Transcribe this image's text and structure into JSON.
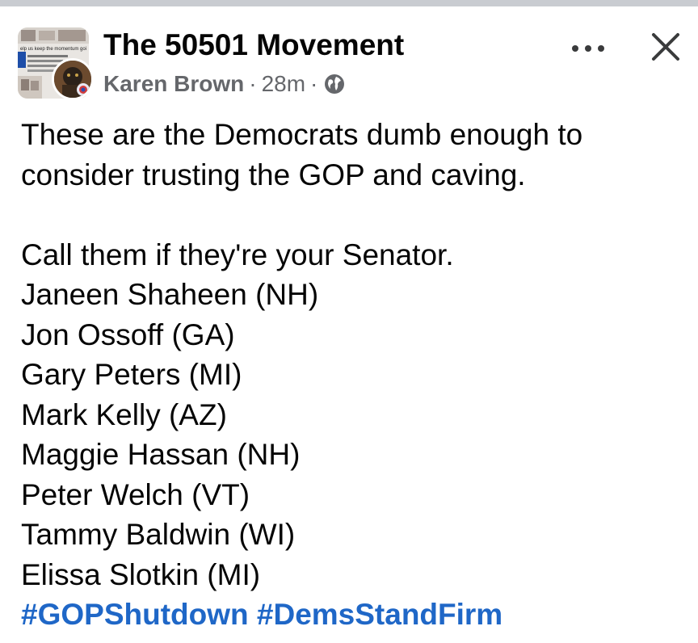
{
  "header": {
    "group_name": "The 50501 Movement",
    "author": "Karen Brown",
    "separator": "·",
    "time": "28m",
    "visibility_icon": "globe-icon",
    "more_icon": "more-horizontal-icon",
    "close_icon": "close-icon",
    "group_thumbnail_text": "elp us keep the momentum goi"
  },
  "post": {
    "intro_lines": [
      "These are the Democrats dumb enough to",
      "consider trusting the GOP and caving."
    ],
    "call_line": "Call them if they're your Senator.",
    "senators": [
      "Janeen Shaheen (NH)",
      "Jon Ossoff (GA)",
      "Gary Peters (MI)",
      "Mark Kelly (AZ)",
      "Maggie Hassan (NH)",
      "Peter Welch (VT)",
      "Tammy Baldwin (WI)",
      "Elissa Slotkin (MI)"
    ],
    "hashtags": [
      "#GOPShutdown",
      "#DemsStandFirm"
    ]
  },
  "colors": {
    "text": "#050505",
    "meta": "#65676b",
    "hashtag": "#1f67c7",
    "top_strip": "#c9ccd1"
  }
}
